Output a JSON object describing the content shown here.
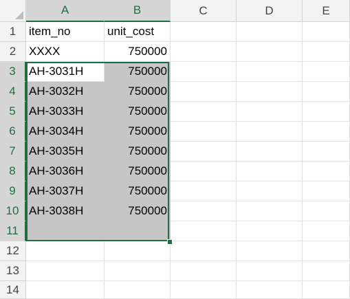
{
  "columns": [
    "A",
    "B",
    "C",
    "D",
    "E"
  ],
  "rows": [
    "1",
    "2",
    "3",
    "4",
    "5",
    "6",
    "7",
    "8",
    "9",
    "10",
    "11",
    "12",
    "13",
    "14"
  ],
  "cells": {
    "A1": "item_no",
    "B1": "unit_cost",
    "A2": "XXXX",
    "B2": "750000",
    "A3": "AH-3031H",
    "B3": "750000",
    "A4": "AH-3032H",
    "B4": "750000",
    "A5": "AH-3033H",
    "B5": "750000",
    "A6": "AH-3034H",
    "B6": "750000",
    "A7": "AH-3035H",
    "B7": "750000",
    "A8": "AH-3036H",
    "B8": "750000",
    "A9": "AH-3037H",
    "B9": "750000",
    "A10": "AH-3038H",
    "B10": "750000"
  },
  "selection": {
    "range": "A3:B11",
    "active_cell": "A3",
    "accent_color": "#1f6e43",
    "highlight_color": "#c6c6c6"
  }
}
